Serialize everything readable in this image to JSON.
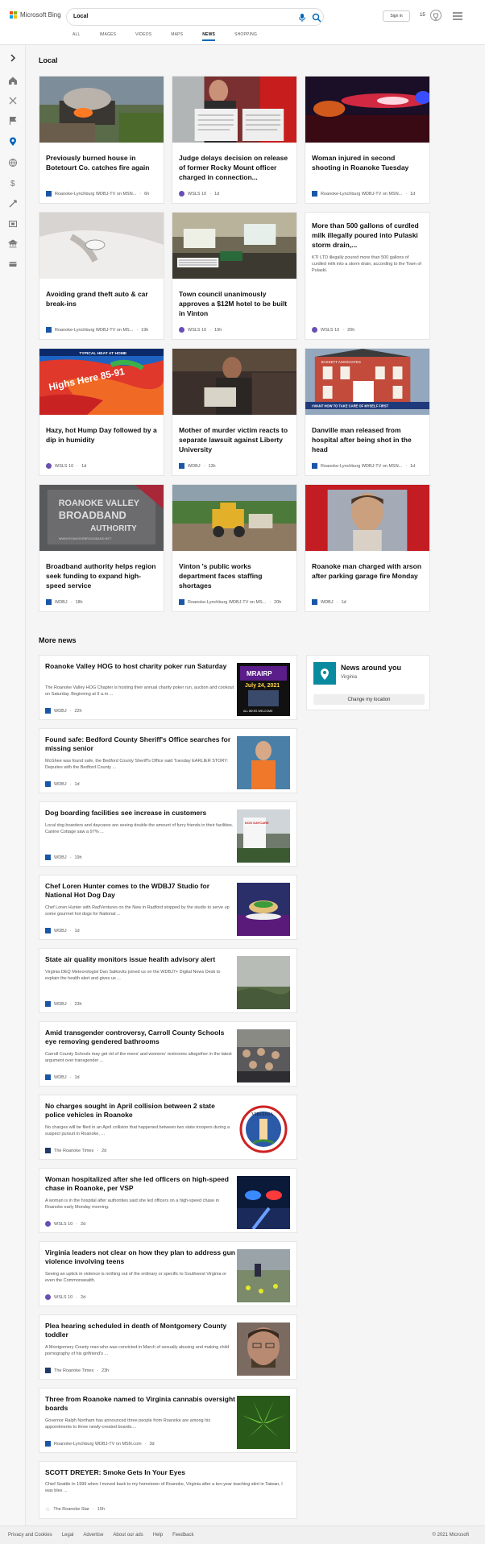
{
  "brand": "Microsoft Bing",
  "search": {
    "query": "Local"
  },
  "tabs": [
    "ALL",
    "IMAGES",
    "VIDEOS",
    "MAPS",
    "NEWS",
    "SHOPPING"
  ],
  "header": {
    "signin": "Sign in",
    "points": "15"
  },
  "local": {
    "heading": "Local",
    "cards": [
      {
        "title": "Previously burned house in Botetourt Co. catches fire again",
        "source": "Roanoke-Lynchburg WDBJ-TV on MSN...",
        "age": "6h"
      },
      {
        "title": "Judge delays decision on release of former Rocky Mount officer charged in connection...",
        "source": "WSLS 10",
        "age": "1d"
      },
      {
        "title": "Woman injured in second shooting in Roanoke Tuesday",
        "source": "Roanoke-Lynchburg WDBJ-TV on MSN...",
        "age": "1d"
      },
      {
        "title": "Avoiding grand theft auto & car break-ins",
        "source": "Roanoke-Lynchburg WDBJ-TV on MS...",
        "age": "19h"
      },
      {
        "title": "Town council unanimously approves a $12M hotel to be built in Vinton",
        "source": "WSLS 10",
        "age": "19h"
      },
      {
        "title": "More than 500 gallons of curdled milk illegally poured into Pulaski storm drain,...",
        "desc": "KTI LTD illegally poured more than 500 gallons of curdled milk into a storm drain, according to the Town of Pulaski.",
        "source": "WSLS 10",
        "age": "20h"
      },
      {
        "title": "Hazy, hot Hump Day followed by a dip in humidity",
        "source": "WSLS 10",
        "age": "1d"
      },
      {
        "title": "Mother of murder victim reacts to separate lawsuit against Liberty University",
        "source": "WDBJ",
        "age": "13h"
      },
      {
        "title": "Danville man released from hospital after being shot in the head",
        "source": "Roanoke-Lynchburg WDBJ-TV on MSN...",
        "age": "1d"
      },
      {
        "title": "Broadband authority helps region seek funding to expand high-speed service",
        "source": "WDBJ",
        "age": "18h"
      },
      {
        "title": "Vinton 's public works department faces staffing shortages",
        "source": "Roanoke-Lynchburg WDBJ-TV on MS...",
        "age": "20h"
      },
      {
        "title": "Roanoke man charged with arson after parking garage fire Monday",
        "source": "WDBJ",
        "age": "1d"
      }
    ],
    "image_text": {
      "map_text": "Highs Here 85-91",
      "map_banner": "TYPICAL HEAT AT HOME",
      "broadband_line1": "ROANOKE VALLEY",
      "broadband_line2": "BROADBAND",
      "broadband_line3": "AUTHORITY",
      "broadband_url": "WWW.ROANOKEBROADBAND.NET",
      "rally_date": "July 24, 2021",
      "rally_name": "MRAIRP",
      "rally_foot": "ALL BIKES WELCOME",
      "hospital_sign": "BASSETT ASSOCIATES",
      "hospital_banner": "I WANT HOW TO TAKE CARE OF MYSELF FIRST",
      "dog_sign": "DOG DAYCARE",
      "seal_text": "VIRGINIA"
    }
  },
  "more": {
    "heading": "More news",
    "items": [
      {
        "title": "Roanoke Valley HOG to host charity poker run Saturday",
        "desc": "The Roanoke Valley HOG Chapter is hosting their annual charity poker run, auction and cookout on Saturday. Beginning at 9 a.m ...",
        "source": "WDBJ",
        "age": "22h"
      },
      {
        "title": "Found safe: Bedford County Sheriff's Office searches for missing senior",
        "desc": "McGhee was found safe, the Bedford County Sheriff's Office said Tuesday EARLIER STORY: Deputies with the Bedford County ...",
        "source": "WDBJ",
        "age": "1d"
      },
      {
        "title": "Dog boarding facilities see increase in customers",
        "desc": "Local dog boarders and daycares are seeing double the amount of furry friends in their facilities. Canine Cottage saw a 97% ...",
        "source": "WDBJ",
        "age": "19h"
      },
      {
        "title": "Chef Loren Hunter comes to the WDBJ7 Studio for National Hot Dog Day",
        "desc": "Chef Loren Hunter with RadVentures on the New in Radford stopped by the studio to serve up some gourmet hot dogs for National ...",
        "source": "WDBJ",
        "age": "1d"
      },
      {
        "title": "State air quality monitors issue health advisory alert",
        "desc": "Virginia DEQ Meteorologist Dan Salkovitz joined us on the WDBJ7+ Digital News Desk to explain the health alert and gives us ...",
        "source": "WDBJ",
        "age": "23h"
      },
      {
        "title": "Amid transgender controversy, Carroll County Schools eye removing gendered bathrooms",
        "desc": "Carroll County Schools may get rid of the mens' and womens' restrooms altogether in the latest argument over transgender ...",
        "source": "WDBJ",
        "age": "1d"
      },
      {
        "title": "No charges sought in April collision between 2 state police vehicles in Roanoke",
        "desc": "No charges will be filed in an April collision that happened between two state troopers during a suspect pursuit in Roanoke, ...",
        "source": "The Roanoke Times",
        "age": "2d"
      },
      {
        "title": "Woman hospitalized after she led officers on high-speed chase in Roanoke, per VSP",
        "desc": "A woman is in the hospital after authorities said she led officers on a high-speed chase in Roanoke early Monday morning.",
        "source": "WSLS 10",
        "age": "2d"
      },
      {
        "title": "Virginia leaders not clear on how they plan to address gun violence involving teens",
        "desc": "Seeing an uptick in violence is nothing out of the ordinary or specific to Southwest Virginia or even the Commonwealth.",
        "source": "WSLS 10",
        "age": "2d"
      },
      {
        "title": "Plea hearing scheduled in death of Montgomery County toddler",
        "desc": "A Montgomery County man who was convicted in March of sexually abusing and making child pornography of his girlfriend's ...",
        "source": "The Roanoke Times",
        "age": "23h"
      },
      {
        "title": "Three from Roanoke named to Virginia cannabis oversight boards",
        "desc": "Governor Ralph Northam has announced three people from Roanoke are among his appointments to three newly-created boards....",
        "source": "Roanoke-Lynchburg WDBJ-TV on MSN.com",
        "age": "3d"
      },
      {
        "title": "SCOTT DREYER: Smoke Gets In Your Eyes",
        "desc": "Chief Seattle In 1999 when I moved back to my hometown of Roanoke, Virginia after a ten-year teaching stint in Taiwan, I was bles ...",
        "source": "The Roanoke Star",
        "age": "15h"
      }
    ]
  },
  "news_around": {
    "title": "News around you",
    "location": "Virginia",
    "button": "Change my location"
  },
  "footer": {
    "links": [
      "Privacy and Cookies",
      "Legal",
      "Advertise",
      "About our ads",
      "Help",
      "Feedback"
    ],
    "copyright": "© 2021 Microsoft"
  },
  "colors": {
    "accent": "#0067b8",
    "wdbj": "#1a56a8",
    "wsls": "#6a4fb3",
    "times": "#223a6a",
    "map_pin": "#0a8a9e"
  },
  "icons": [
    "chevron-right-icon",
    "home-icon",
    "sports-icon",
    "flag-icon",
    "location-icon",
    "globe-icon",
    "money-icon",
    "science-icon",
    "entertainment-icon",
    "politics-icon",
    "card-icon"
  ]
}
